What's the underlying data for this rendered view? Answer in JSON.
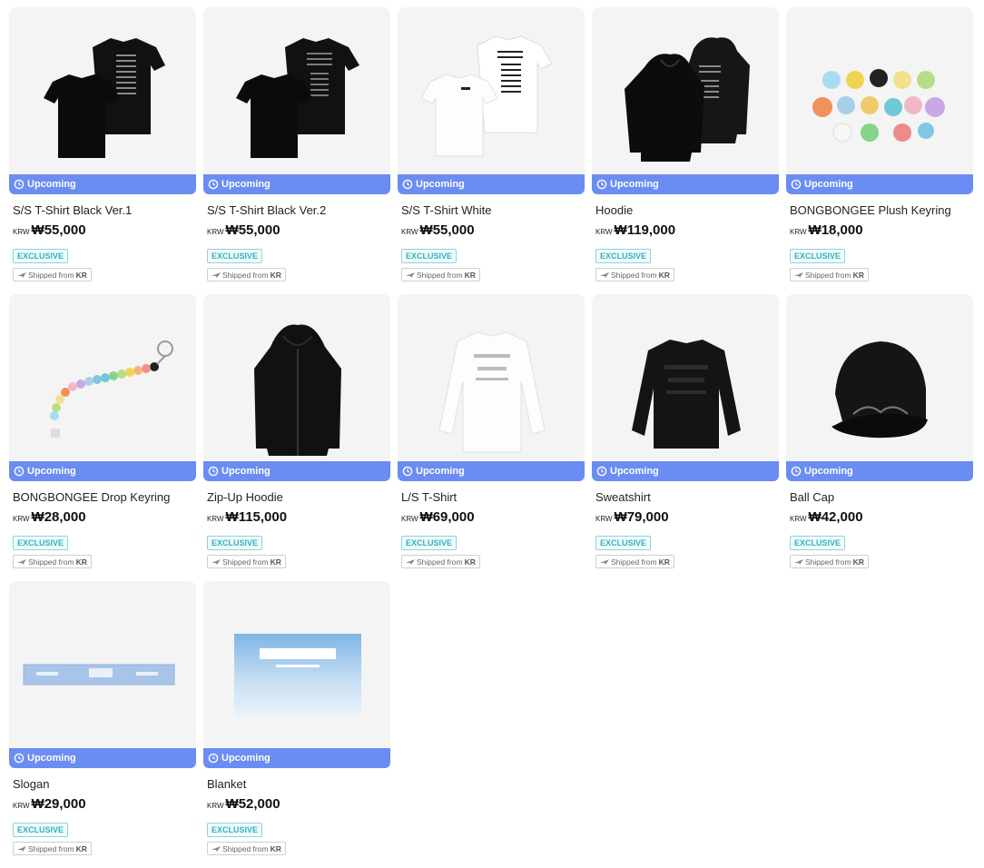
{
  "status_label": "Upcoming",
  "currency": "KRW",
  "exclusive_label": "EXCLUSIVE",
  "shipped_label": "Shipped from",
  "ship_country": "KR",
  "colors": {
    "upcoming_bg": "#6b8cf2",
    "exclusive": "#2bb3c0",
    "thumb_bg": "#f4f4f5"
  },
  "products": [
    {
      "name": "S/S T-Shirt Black Ver.1",
      "price": "₩55,000",
      "icon": "black-tshirt-pair"
    },
    {
      "name": "S/S T-Shirt Black Ver.2",
      "price": "₩55,000",
      "icon": "black-tshirt-pair"
    },
    {
      "name": "S/S T-Shirt White",
      "price": "₩55,000",
      "icon": "white-tshirt-pair"
    },
    {
      "name": "Hoodie",
      "price": "₩119,000",
      "icon": "black-hoodie-pair"
    },
    {
      "name": "BONGBONGEE Plush Keyring",
      "price": "₩18,000",
      "icon": "plush-keyrings"
    },
    {
      "name": "BONGBONGEE Drop Keyring",
      "price": "₩28,000",
      "icon": "drop-keyring"
    },
    {
      "name": "Zip-Up Hoodie",
      "price": "₩115,000",
      "icon": "zip-hoodie"
    },
    {
      "name": "L/S T-Shirt",
      "price": "₩69,000",
      "icon": "white-longsleeve"
    },
    {
      "name": "Sweatshirt",
      "price": "₩79,000",
      "icon": "black-sweatshirt"
    },
    {
      "name": "Ball Cap",
      "price": "₩42,000",
      "icon": "black-cap"
    },
    {
      "name": "Slogan",
      "price": "₩29,000",
      "icon": "slogan-towel"
    },
    {
      "name": "Blanket",
      "price": "₩52,000",
      "icon": "blue-blanket"
    }
  ]
}
